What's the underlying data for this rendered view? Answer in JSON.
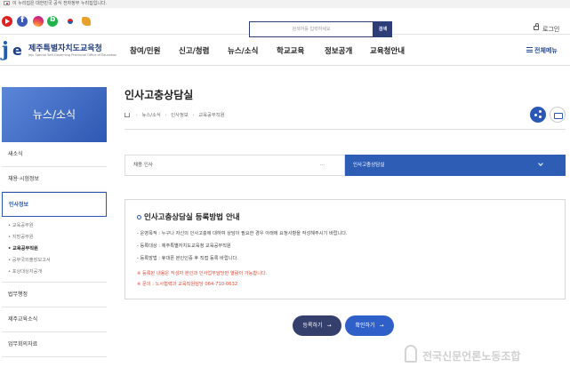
{
  "gov_banner": {
    "text": "이 누리집은 대한민국 공식 전자정부 누리집입니다."
  },
  "util": {
    "search_placeholder": "검색어를 입력하세요",
    "search_button": "검색",
    "login": "로그인"
  },
  "header": {
    "logo_name": "제주특별자치도교육청",
    "logo_sub": "Jeju Special Self-Governing Provincial Office of Education",
    "nav": [
      "참여/민원",
      "신고/청렴",
      "뉴스/소식",
      "학교교육",
      "정보공개",
      "교육청안내"
    ],
    "all_menu": "전체메뉴"
  },
  "sidebar": {
    "title": "뉴스/소식",
    "items": [
      "새소식",
      "채용·시험정보",
      "인사정보"
    ],
    "sub_items": [
      "교육공무원",
      "지방공무원",
      "교육공무직원",
      "공무국외출장보고서",
      "포상대상자공개"
    ],
    "bottom_items": [
      "법무행정",
      "제주교육소식",
      "업무회의자료"
    ]
  },
  "main": {
    "title": "인사고충상담실",
    "breadcrumb": [
      "뉴스/소식",
      "인사정보",
      "교육공무직원"
    ],
    "select_left": "채용·인사",
    "select_left_dots": "···",
    "select_right": "인사고충상담실",
    "info": {
      "title": "인사고충상담실 등록방법 안내",
      "lines": [
        "운영목적 : 누구나 자신의 인사고충에 대하여 상담이 필요한 경우 아래에 요청사항을 작성해주시기 바랍니다.",
        "등록대상 : 제주특별자치도교육청 교육공무직원",
        "등록방법 : 휴대폰 본인인증 후 직접 등록 바랍니다."
      ],
      "notes": [
        "※ 등록된 내용은 작성자 본인과 인사업무담당만 열람이 가능합니다.",
        "※ 문의 : 노사협력과 교육직원담당 064-710-0632"
      ]
    },
    "buttons": {
      "register": "등록하기",
      "confirm": "확인하기",
      "arrow": "→"
    }
  },
  "watermark": "전국신문언론노동조합",
  "colors": {
    "primary": "#2e5db5",
    "dark_button": "#343f6c",
    "note_red": "#e04a3a"
  }
}
